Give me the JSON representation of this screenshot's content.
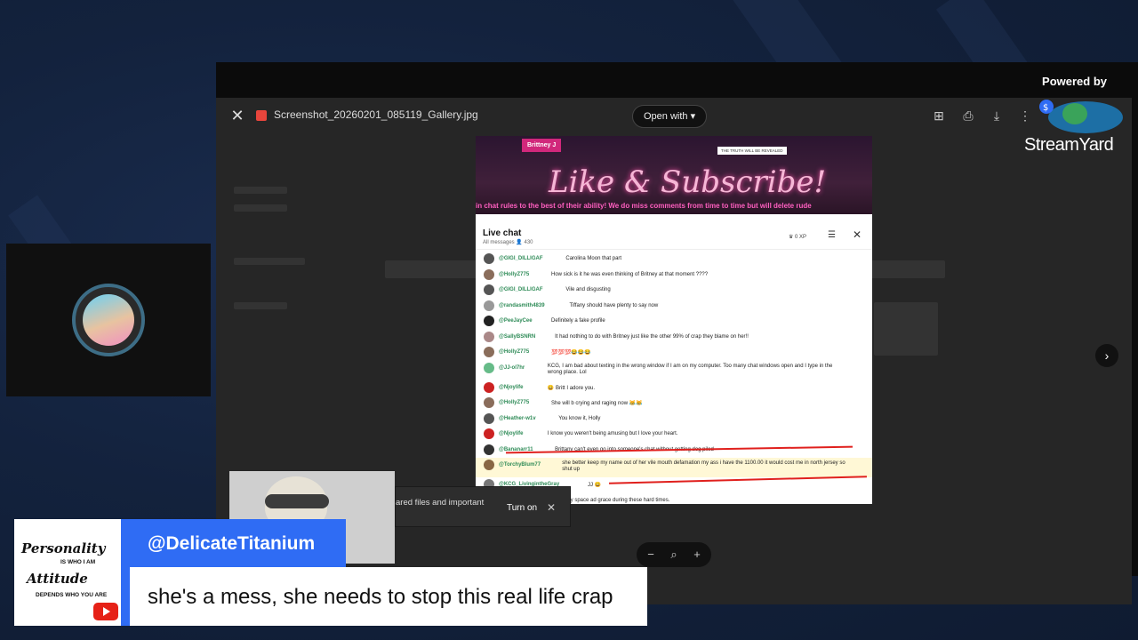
{
  "viewer": {
    "file_name": "Screenshot_20260201_085119_Gallery.jpg",
    "open_with_label": "Open with ▾",
    "close_icon": "close-icon",
    "toolbar_icons": [
      "comment-icon",
      "print-icon",
      "download-icon",
      "more-vert-icon"
    ]
  },
  "streamyard": {
    "powered_by": "Powered by",
    "brand": "StreamYard"
  },
  "shot": {
    "banner_name": "Brittney J",
    "banner_tag": "THE TRUTH WILL BE REVEALED",
    "banner_title": "Like & Subscribe!",
    "ticker": "in chat rules to the best of their ability! We do miss comments from time to time but will delete rude",
    "chat_title": "Live chat",
    "chat_sub": "All messages  👤 430",
    "chat_xp": "♛ 0 XP",
    "messages": [
      {
        "user": "@GIGI_DILLIGAF",
        "text": "Carolina Moon that part",
        "color": "#555"
      },
      {
        "user": "@HollyZ775",
        "text": "How sick is it he was even thinking of Britney at that moment ????",
        "color": "#8a6d5b"
      },
      {
        "user": "@GIGI_DILLIGAF",
        "text": "Vile and disgusting",
        "color": "#555"
      },
      {
        "user": "@randasmith4839",
        "text": "Tiffany should have plenty to say now",
        "color": "#999"
      },
      {
        "user": "@PeeJayCee",
        "text": "Definitely a fake profile",
        "color": "#222"
      },
      {
        "user": "@SallyBSNRN",
        "text": "It had nothing to do with Britney just like the other 99% of crap they blame on her!!",
        "color": "#a88"
      },
      {
        "user": "@HollyZ775",
        "text": "💯💯💯😂😂😂",
        "color": "#8a6d5b"
      },
      {
        "user": "@JJ-ol7hr",
        "text": "KCG, I am bad about texting in the wrong window if I am on my computer. Too many chat windows open and I type in the wrong place. Lol",
        "color": "#6b8",
        "tall": true
      },
      {
        "user": "@Njoylife",
        "text": "😀 Britt I adore you.",
        "color": "#c22"
      },
      {
        "user": "@HollyZ775",
        "text": "She will b crying and raging now 😹😹",
        "color": "#8a6d5b"
      },
      {
        "user": "@Heather-w1v",
        "text": "You know it, Holly",
        "color": "#555"
      },
      {
        "user": "@Njoylife",
        "text": "I know you weren't being amusing but I love your heart.",
        "color": "#c22"
      },
      {
        "user": "@Bananarr11",
        "text": "Brittany can't even go into someone's chat without getting dog piled",
        "color": "#333"
      },
      {
        "user": "@TorchyBlum77",
        "text": "she better keep my name out of her vile mouth defamation my ass i have the 1100.00 it would cost me in north jersey so shut up",
        "color": "#864",
        "tall": true,
        "hl": true
      },
      {
        "user": "@KCG_LivingintheGray",
        "text": "JJ 😀",
        "color": "#777"
      },
      {
        "user": "",
        "text": "Tiffany space ad grace during these hard times.",
        "color": "#777"
      }
    ]
  },
  "toast": {
    "text": "ared files and important",
    "button": "Turn on"
  },
  "overlay": {
    "logo_line1": "Personality",
    "logo_line2": "IS WHO I AM",
    "logo_line3": "Attitude",
    "logo_line4": "DEPENDS WHO YOU ARE",
    "name": "@DelicateTitanium",
    "comment": "she's a mess, she needs to stop this real life crap"
  },
  "colors": {
    "accent_blue": "#2f6cf4",
    "youtube_red": "#e62117",
    "background": "#13223d"
  }
}
